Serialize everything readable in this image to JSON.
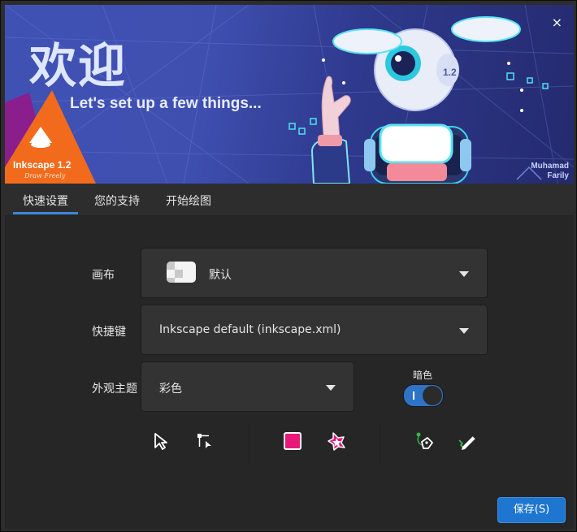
{
  "banner": {
    "title": "欢迎",
    "subtitle": "Let's set up a few things...",
    "logo_name": "Inkscape 1.2",
    "logo_tagline": "Draw Freely",
    "version_badge": "1.2",
    "artist_credit": [
      "Muhamad",
      "Farily"
    ],
    "close_glyph": "×"
  },
  "tabs": [
    {
      "label": "快速设置",
      "active": true
    },
    {
      "label": "您的支持",
      "active": false
    },
    {
      "label": "开始绘图",
      "active": false
    }
  ],
  "settings": {
    "canvas": {
      "label": "画布",
      "value": "默认"
    },
    "keys": {
      "label": "快捷键",
      "value": "Inkscape default (inkscape.xml)"
    },
    "theme": {
      "label": "外观主题",
      "value": "彩色"
    },
    "dark": {
      "label": "暗色",
      "on": true
    }
  },
  "toolbar": {
    "icons": [
      "pointer-icon",
      "node-tool-icon",
      "square-icon",
      "star-icon",
      "pen-icon",
      "pencil-icon"
    ]
  },
  "colors": {
    "accent": "#1e76d0",
    "pink": "#e8197a",
    "green": "#3bb34a"
  },
  "footer": {
    "save_label": "保存(S)"
  }
}
